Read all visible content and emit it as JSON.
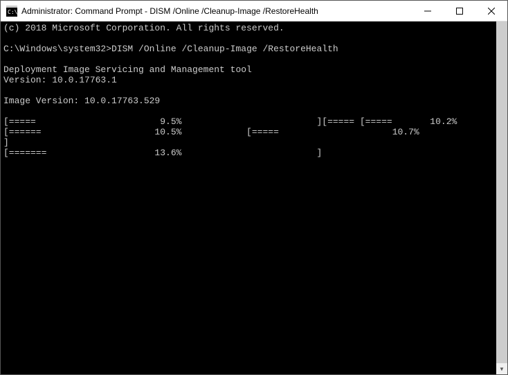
{
  "titlebar": {
    "title": "Administrator: Command Prompt - DISM  /Online /Cleanup-Image /RestoreHealth"
  },
  "console": {
    "copyright": "(c) 2018 Microsoft Corporation. All rights reserved.",
    "prompt": "C:\\Windows\\system32>",
    "command": "DISM /Online /Cleanup-Image /RestoreHealth",
    "toolName": "Deployment Image Servicing and Management tool",
    "version": "Version: 10.0.17763.1",
    "imageVersion": "Image Version: 10.0.17763.529",
    "progressText": "[=====                       9.5%                         ][===== [=====       10.2%                         [======                     10.5%            [=====                     10.7%                          ]\n[=======                    13.6%                         ]"
  }
}
